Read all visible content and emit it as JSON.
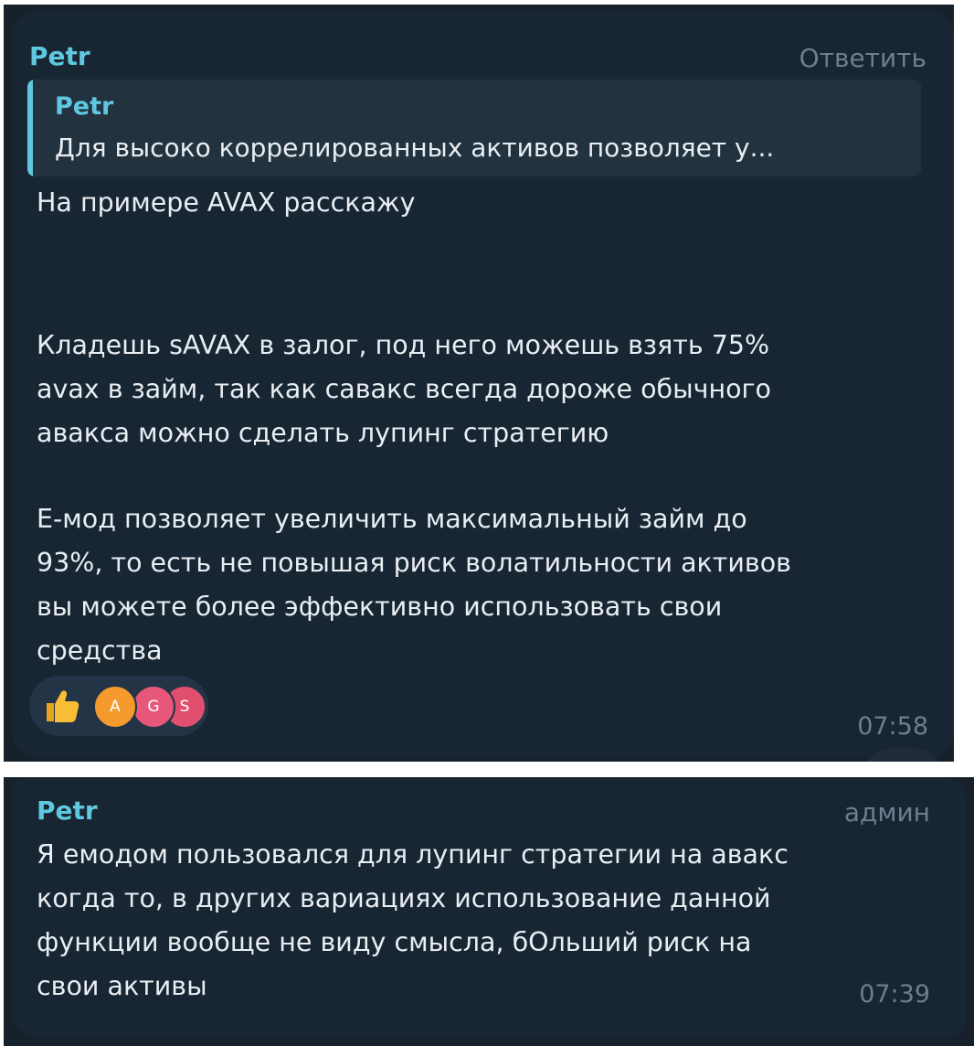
{
  "messages": [
    {
      "sender": "Petr",
      "action_label": "Ответить",
      "reply": {
        "sender": "Petr",
        "text": "Для высоко коррелированных активов позволяет у..."
      },
      "lines": [
        "На примере AVAX расскажу",
        "Кладешь sAVAX в залог, под него можешь взять 75%",
        "avax в займ, так как савакс всегда дороже обычного",
        "авакса можно сделать лупинг стратегию",
        "Е-мод позволяет увеличить максимальный займ до",
        "93%, то есть не повышая риск волатильности активов",
        "вы можете более эффективно использовать свои",
        "средства"
      ],
      "reactions": {
        "emoji_icon": "thumbs-up-icon",
        "avatars": [
          "A",
          "G",
          "S"
        ],
        "avatar_colors": [
          "#f59b2d",
          "#e7577a",
          "#e04f6e"
        ]
      },
      "time": "07:58"
    },
    {
      "sender": "Petr",
      "badge": "админ",
      "lines": [
        "Я емодом пользовался для лупинг стратегии на авакс",
        "когда то, в других вариациях использование данной",
        "функции вообще не виду смысла, бОльший риск на",
        "свои активы"
      ],
      "time": "07:39"
    }
  ],
  "colors": {
    "background": "#17212b",
    "bubble": "#182533",
    "accent": "#5fc8e0",
    "text": "#e9eef3",
    "muted": "#6d7f8f"
  }
}
